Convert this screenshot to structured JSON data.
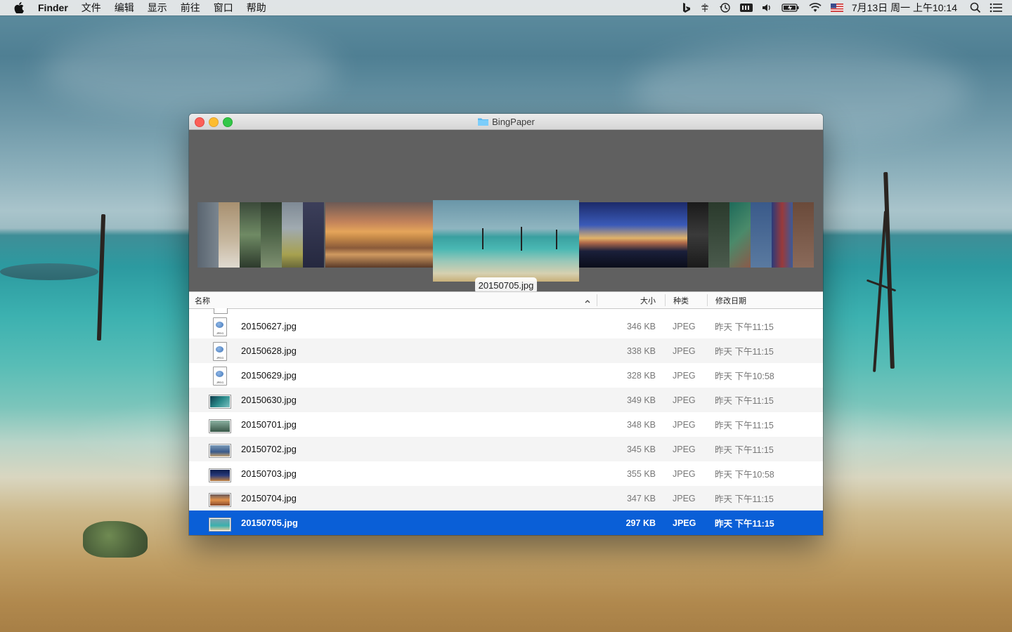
{
  "menubar": {
    "app_name": "Finder",
    "menus": [
      "文件",
      "编辑",
      "显示",
      "前往",
      "窗口",
      "帮助"
    ],
    "status_icons": [
      "bing-icon",
      "input-method-icon",
      "time-machine-icon",
      "battery-meter-icon",
      "volume-icon",
      "battery-icon",
      "wifi-icon",
      "us-flag-icon"
    ],
    "clock": "7月13日 周一 上午10:14"
  },
  "window": {
    "title": "BingPaper",
    "coverflow_label": "20150705.jpg",
    "columns": {
      "name": "名称",
      "size": "大小",
      "kind": "种类",
      "date": "修改日期"
    },
    "files": [
      {
        "name": "20150627.jpg",
        "size": "346 KB",
        "kind": "JPEG",
        "date": "昨天 下午11:15",
        "icon": "jpeg-doc"
      },
      {
        "name": "20150628.jpg",
        "size": "338 KB",
        "kind": "JPEG",
        "date": "昨天 下午11:15",
        "icon": "jpeg-doc"
      },
      {
        "name": "20150629.jpg",
        "size": "328 KB",
        "kind": "JPEG",
        "date": "昨天 下午10:58",
        "icon": "jpeg-doc"
      },
      {
        "name": "20150630.jpg",
        "size": "349 KB",
        "kind": "JPEG",
        "date": "昨天 下午11:15",
        "icon": "thumb"
      },
      {
        "name": "20150701.jpg",
        "size": "348 KB",
        "kind": "JPEG",
        "date": "昨天 下午11:15",
        "icon": "thumb"
      },
      {
        "name": "20150702.jpg",
        "size": "345 KB",
        "kind": "JPEG",
        "date": "昨天 下午11:15",
        "icon": "thumb"
      },
      {
        "name": "20150703.jpg",
        "size": "355 KB",
        "kind": "JPEG",
        "date": "昨天 下午10:58",
        "icon": "thumb"
      },
      {
        "name": "20150704.jpg",
        "size": "347 KB",
        "kind": "JPEG",
        "date": "昨天 下午11:15",
        "icon": "thumb"
      },
      {
        "name": "20150705.jpg",
        "size": "297 KB",
        "kind": "JPEG",
        "date": "昨天 下午11:15",
        "icon": "thumb",
        "selected": true
      }
    ]
  },
  "colors": {
    "selection": "#0a5fd7",
    "coverflow_bg": "#606060"
  }
}
